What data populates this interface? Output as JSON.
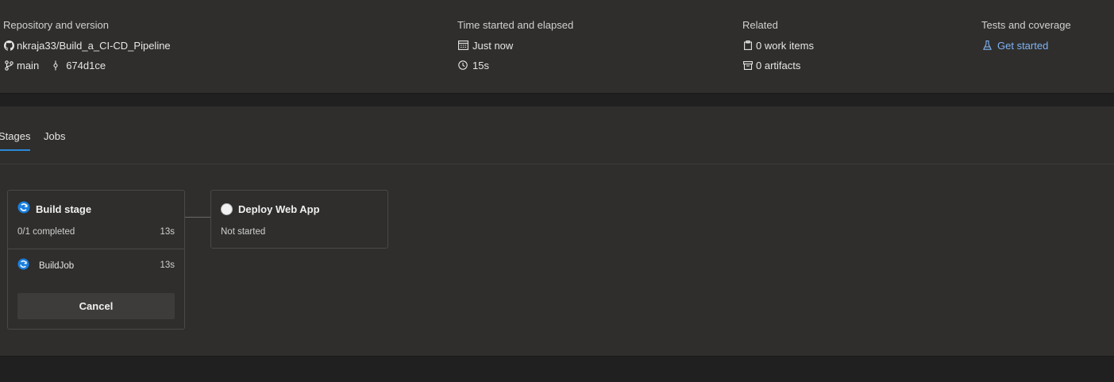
{
  "summary": {
    "repo": {
      "title": "Repository and version",
      "repo_name": "nkraja33/Build_a_CI-CD_Pipeline",
      "branch": "main",
      "commit": "674d1ce"
    },
    "time": {
      "title": "Time started and elapsed",
      "started": "Just now",
      "elapsed": "15s"
    },
    "related": {
      "title": "Related",
      "work_items": "0 work items",
      "artifacts": "0 artifacts"
    },
    "tests": {
      "title": "Tests and coverage",
      "link": "Get started"
    }
  },
  "tabs": {
    "stages": "Stages",
    "jobs": "Jobs",
    "selected": "Stages"
  },
  "stages": {
    "build": {
      "name": "Build stage",
      "progress": "0/1 completed",
      "duration": "13s",
      "status": "running",
      "job": {
        "name": "BuildJob",
        "duration": "13s",
        "status": "running"
      },
      "cancel_label": "Cancel"
    },
    "deploy": {
      "name": "Deploy Web App",
      "status_text": "Not started",
      "status": "not-started"
    }
  },
  "colors": {
    "accent": "#2b88d8",
    "link": "#7fb3f5",
    "running": "#1a7fe0"
  }
}
